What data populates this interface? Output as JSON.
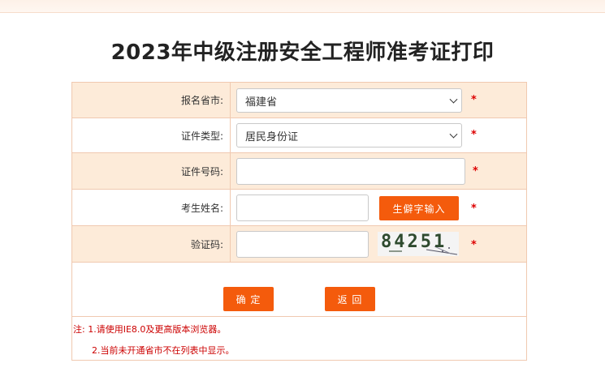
{
  "page": {
    "title": "2023年中级注册安全工程师准考证打印"
  },
  "form": {
    "province": {
      "label": "报名省市:",
      "value": "福建省"
    },
    "id_type": {
      "label": "证件类型:",
      "value": "居民身份证"
    },
    "id_number": {
      "label": "证件号码:",
      "value": ""
    },
    "name": {
      "label": "考生姓名:",
      "value": "",
      "rare_char_button": "生僻字输入"
    },
    "captcha": {
      "label": "验证码:",
      "value": "",
      "image_text": "84251"
    },
    "required_mark": "*"
  },
  "actions": {
    "confirm": "确 定",
    "back": "返 回"
  },
  "notes": {
    "line1": "注: 1.请使用IE8.0及更高版本浏览器。",
    "line2": "2.当前未开通省市不在列表中显示。"
  },
  "colors": {
    "accent": "#f45b0c",
    "row_shade": "#fdebd9",
    "border": "#f0c9b0",
    "note": "#cc0000"
  }
}
